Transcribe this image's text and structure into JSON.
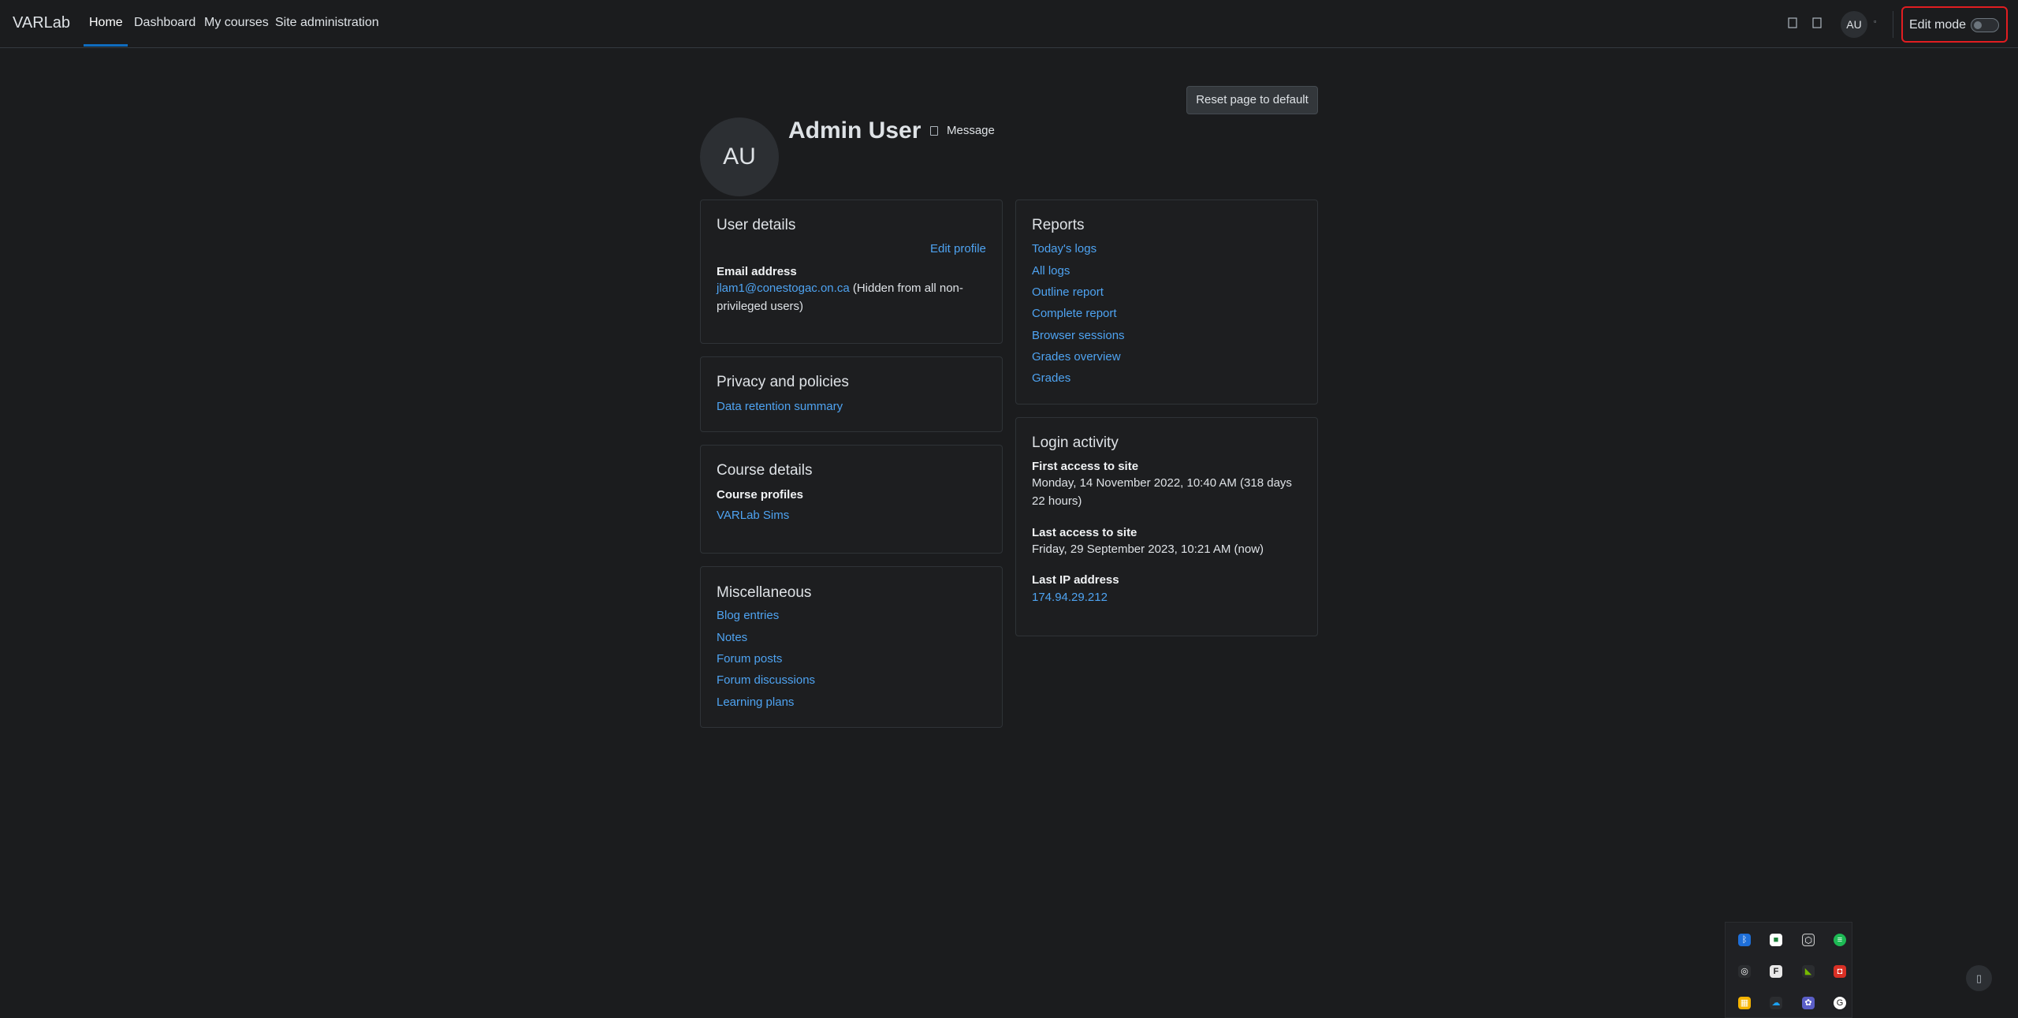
{
  "navbar": {
    "brand": "VARLab",
    "items": [
      "Home",
      "Dashboard",
      "My courses",
      "Site administration"
    ],
    "user_initials": "AU",
    "edit_mode_label": "Edit mode"
  },
  "page": {
    "reset_button": "Reset page to default",
    "avatar_initials": "AU",
    "fullname": "Admin User",
    "message_label": "Message"
  },
  "user_details": {
    "title": "User details",
    "edit_profile": "Edit profile",
    "email_label": "Email address",
    "email": "jlam1@conestogac.on.ca",
    "email_note_line1": "(Hidden from all non-",
    "email_note_line2": "privileged users)"
  },
  "privacy": {
    "title": "Privacy and policies",
    "link": "Data retention summary"
  },
  "course_details": {
    "title": "Course details",
    "label": "Course profiles",
    "link": "VARLab Sims"
  },
  "misc": {
    "title": "Miscellaneous",
    "links": [
      "Blog entries",
      "Notes",
      "Forum posts",
      "Forum discussions",
      "Learning plans"
    ]
  },
  "reports": {
    "title": "Reports",
    "links": [
      "Today's logs",
      "All logs",
      "Outline report",
      "Complete report",
      "Browser sessions",
      "Grades overview",
      "Grades"
    ]
  },
  "login_activity": {
    "title": "Login activity",
    "first_label": "First access to site",
    "first_line1": "Monday, 14 November 2022, 10:40 AM  (318 days",
    "first_line2": "22 hours)",
    "last_label": "Last access to site",
    "last_value": "Friday, 29 September 2023, 10:21 AM  (now)",
    "ip_label": "Last IP address",
    "ip_value": "174.94.29.212"
  },
  "colors": {
    "background": "#1b1c1e",
    "link": "#4ea3f1",
    "edit_mode_highlight": "#e11d21",
    "nav_active": "#0f6cbf"
  },
  "tray_icons": [
    "bluetooth-icon",
    "shield-icon",
    "box-icon",
    "spotify-icon",
    "layers-icon",
    "font-icon",
    "nvidia-icon",
    "remote-icon",
    "image-icon",
    "cloud-icon",
    "teams-icon",
    "google-icon"
  ]
}
